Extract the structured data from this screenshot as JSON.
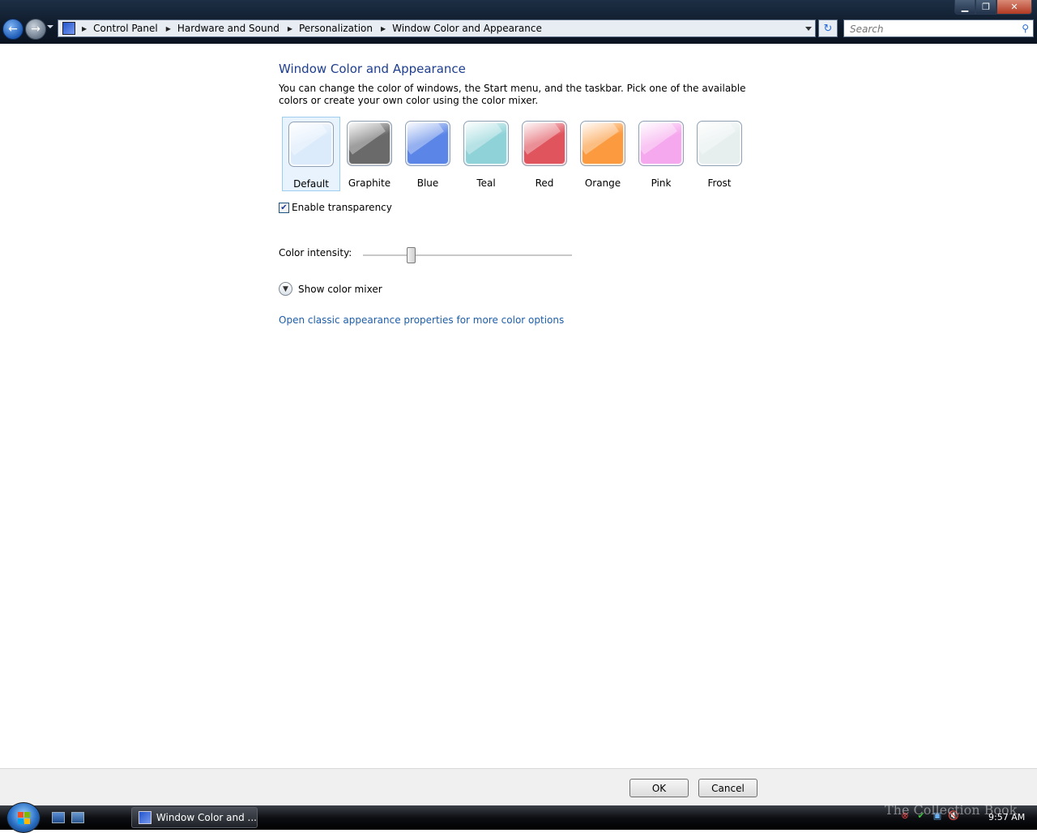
{
  "window": {
    "minimize_glyph": "▁",
    "maximize_glyph": "❐",
    "close_glyph": "✕"
  },
  "address_bar": {
    "breadcrumbs": [
      "Control Panel",
      "Hardware and Sound",
      "Personalization",
      "Window Color and Appearance"
    ],
    "search_placeholder": "Search"
  },
  "content": {
    "title": "Window Color and Appearance",
    "description": "You can change the color of windows, the Start menu, and the taskbar. Pick one of the available colors or create your own color using the color mixer.",
    "swatches": [
      {
        "label": "Default",
        "color": "#dcebfb",
        "selected": true
      },
      {
        "label": "Graphite",
        "color": "#6a6a6a",
        "selected": false
      },
      {
        "label": "Blue",
        "color": "#5b86e8",
        "selected": false
      },
      {
        "label": "Teal",
        "color": "#8fd3d8",
        "selected": false
      },
      {
        "label": "Red",
        "color": "#e0545e",
        "selected": false
      },
      {
        "label": "Orange",
        "color": "#fb9a3e",
        "selected": false
      },
      {
        "label": "Pink",
        "color": "#f6a8ee",
        "selected": false
      },
      {
        "label": "Frost",
        "color": "#e6efee",
        "selected": false
      }
    ],
    "transparency": {
      "label": "Enable transparency",
      "checked": true
    },
    "intensity": {
      "label": "Color intensity:",
      "value_fraction": 0.23
    },
    "mixer_toggle": {
      "label": "Show color mixer"
    },
    "classic_link": "Open classic appearance properties for more color options"
  },
  "buttons": {
    "ok": "OK",
    "cancel": "Cancel"
  },
  "taskbar": {
    "task_label": "Window Color and ...",
    "clock": "9:57 AM",
    "windows_logo_colors": [
      "#f25022",
      "#7fba00",
      "#00a4ef",
      "#ffb900"
    ]
  },
  "watermark": "The Collection Book"
}
